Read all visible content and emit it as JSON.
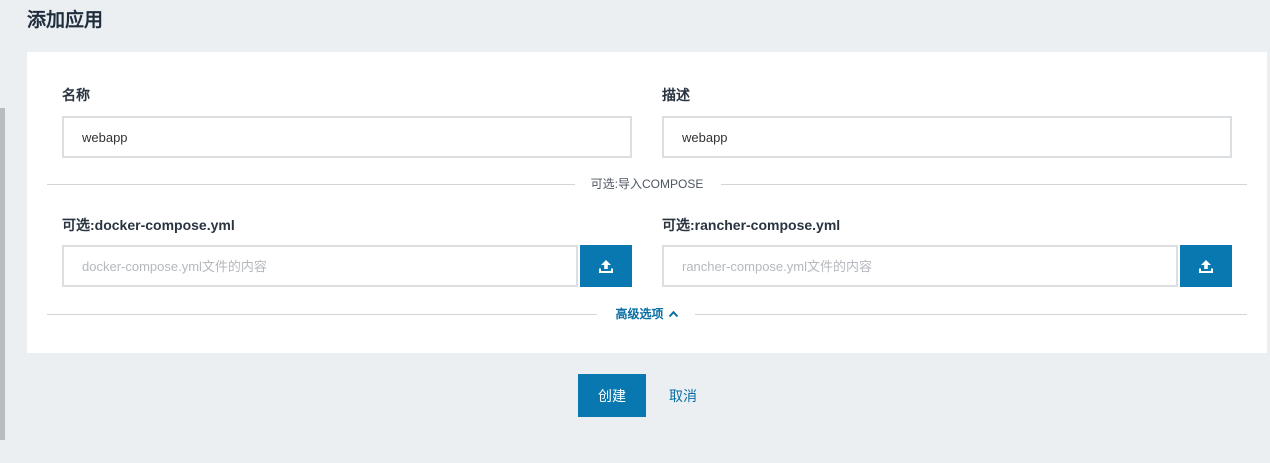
{
  "page": {
    "title": "添加应用"
  },
  "form": {
    "name_label": "名称",
    "name_value": "webapp",
    "description_label": "描述",
    "description_value": "webapp"
  },
  "compose": {
    "divider_label": "可选:导入COMPOSE",
    "docker_label": "可选:docker-compose.yml",
    "docker_placeholder": "docker-compose.yml文件的内容",
    "rancher_label": "可选:rancher-compose.yml",
    "rancher_placeholder": "rancher-compose.yml文件的内容",
    "upload_icon": "upload-icon"
  },
  "advanced": {
    "toggle_label": "高级选项",
    "toggle_icon": "chevron-up-icon"
  },
  "actions": {
    "create_label": "创建",
    "cancel_label": "取消"
  },
  "colors": {
    "primary": "#0a78b0",
    "link": "#0a6ea2",
    "background": "#eceff1"
  }
}
